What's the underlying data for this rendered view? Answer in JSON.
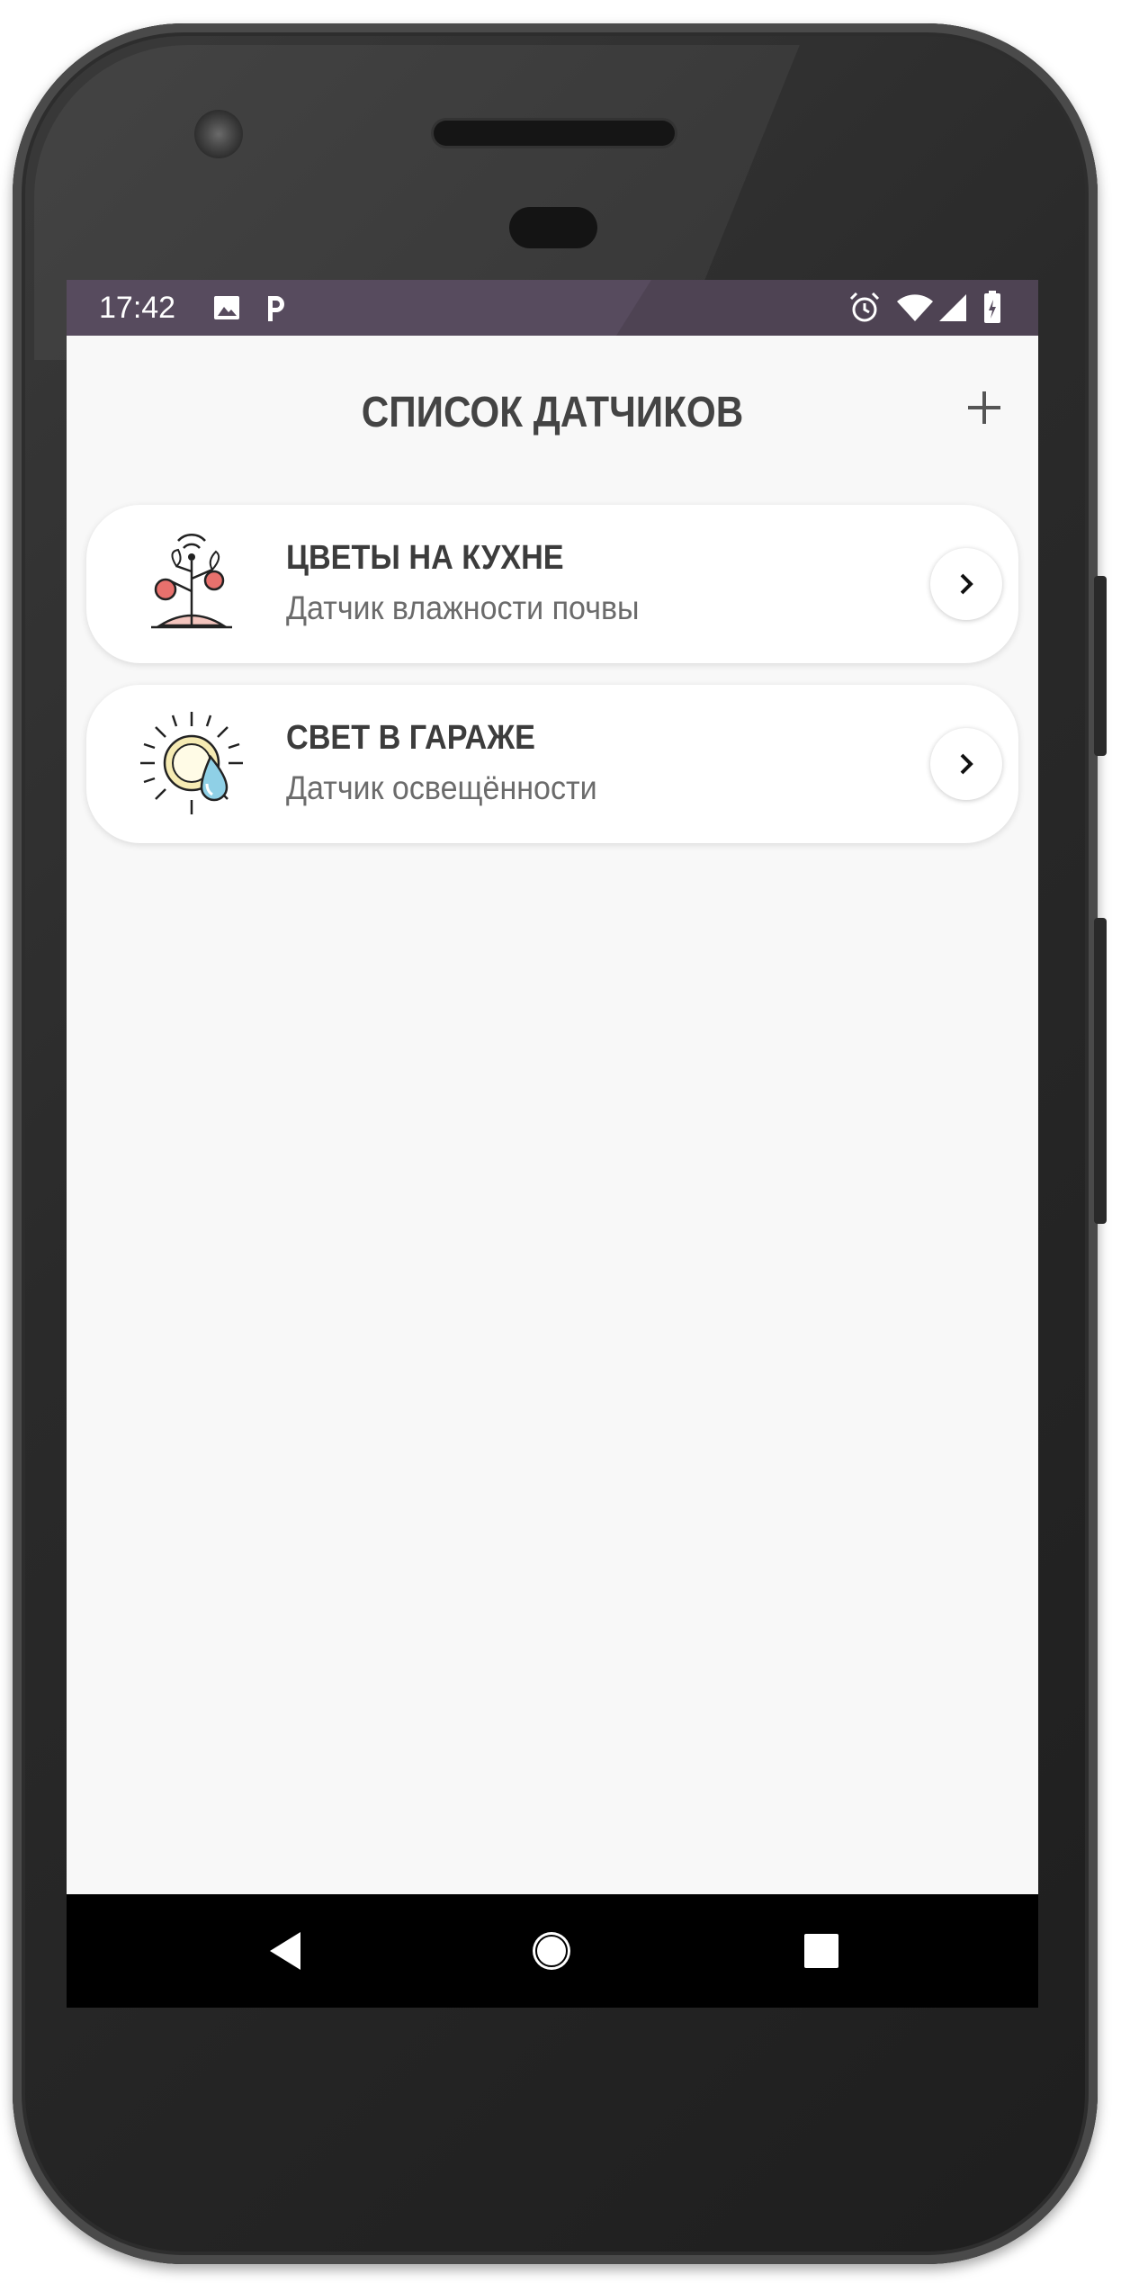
{
  "status_bar": {
    "time": "17:42",
    "left_icons": [
      "image-icon",
      "parking-icon"
    ],
    "right_icons": [
      "alarm-icon",
      "wifi-icon",
      "signal-icon",
      "battery-charging-icon"
    ]
  },
  "header": {
    "title": "СПИСОК ДАТЧИКОВ",
    "add_icon": "plus-icon"
  },
  "sensors": [
    {
      "name": "ЦВЕТЫ НА КУХНЕ",
      "type": "Датчик влажности почвы",
      "icon": "plant-sensor-icon"
    },
    {
      "name": "СВЕТ В ГАРАЖЕ",
      "type": "Датчик освещённости",
      "icon": "sun-drop-icon"
    }
  ],
  "nav": {
    "icons": [
      "back-icon",
      "home-icon",
      "recents-icon"
    ]
  },
  "colors": {
    "status_bar": "#574b5e",
    "background": "#f8f8f8",
    "card": "#ffffff",
    "title_text": "#444444",
    "accent_red": "#e8716d",
    "accent_blue": "#8fd0e6"
  }
}
